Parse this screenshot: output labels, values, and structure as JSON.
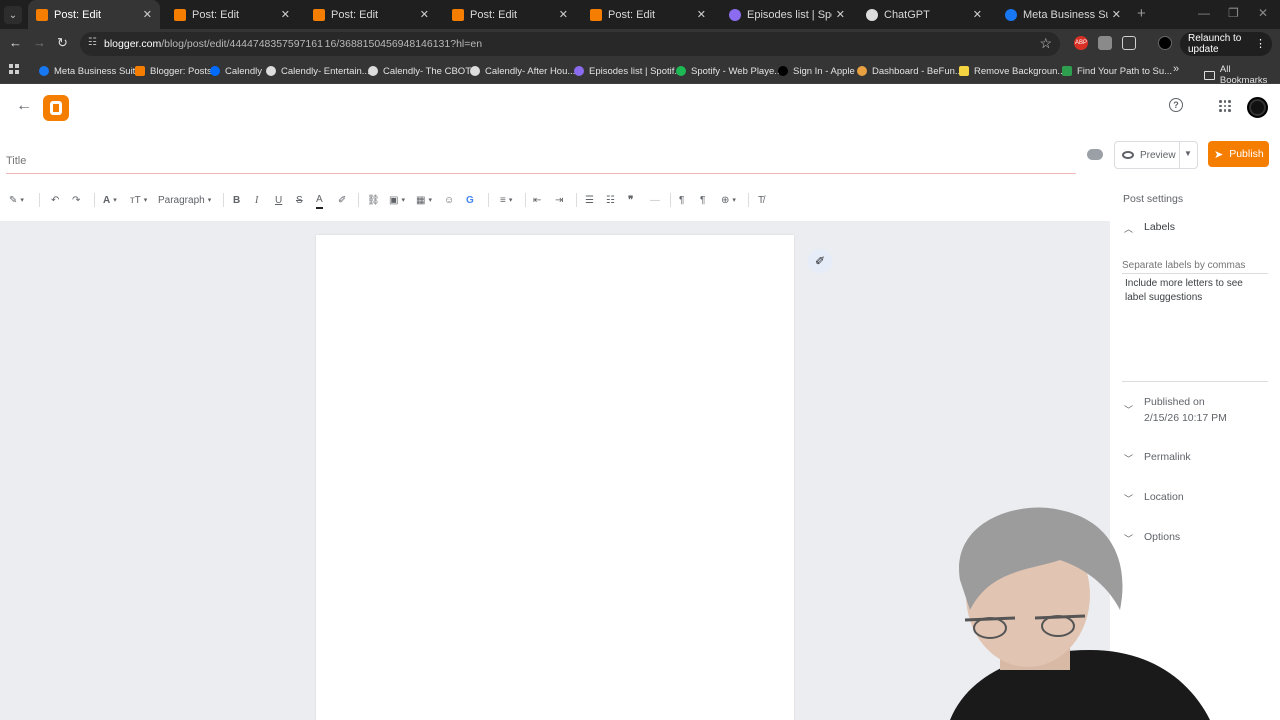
{
  "browser": {
    "tabs": [
      {
        "label": "Post: Edit",
        "color": "#f57d00",
        "active": true
      },
      {
        "label": "Post: Edit",
        "color": "#f57d00"
      },
      {
        "label": "Post: Edit",
        "color": "#f57d00"
      },
      {
        "label": "Post: Edit",
        "color": "#f57d00"
      },
      {
        "label": "Post: Edit",
        "color": "#f57d00"
      },
      {
        "label": "Episodes list | Spotify for",
        "color": "#8b6cf0"
      },
      {
        "label": "ChatGPT",
        "color": "#dddddd"
      },
      {
        "label": "Meta Business Suite",
        "color": "#1877f2"
      }
    ],
    "url_host": "blogger.com",
    "url_path": "/blog/post/edit/4444748357597161 16/3688150456948146131?hl=en",
    "relaunch_label": "Relaunch to update",
    "bookmarks": [
      "Meta Business Suite",
      "Blogger: Posts",
      "Calendly",
      "Calendly- Entertain...",
      "Calendly- The CBOT...",
      "Calendly- After Hou...",
      "Episodes list | Spotif...",
      "Spotify - Web Playe...",
      "Sign In - Apple",
      "Dashboard - BeFun...",
      "Remove Backgroun...",
      "Find Your Path to Su..."
    ],
    "all_bookmarks": "All Bookmarks"
  },
  "editor": {
    "title_placeholder": "Title",
    "preview_label": "Preview",
    "publish_label": "Publish",
    "paragraph_label": "Paragraph"
  },
  "sidebar": {
    "heading": "Post settings",
    "labels_title": "Labels",
    "labels_placeholder": "Separate labels by commas",
    "labels_hint": "Include more letters to see label suggestions",
    "published_on": "Published on",
    "published_date": "2/15/26 10:17 PM",
    "permalink": "Permalink",
    "location": "Location",
    "options": "Options"
  },
  "colors": {
    "accent": "#f57d00",
    "chrome_dark": "#1f1f1f",
    "chrome_toolbar": "#353535"
  }
}
